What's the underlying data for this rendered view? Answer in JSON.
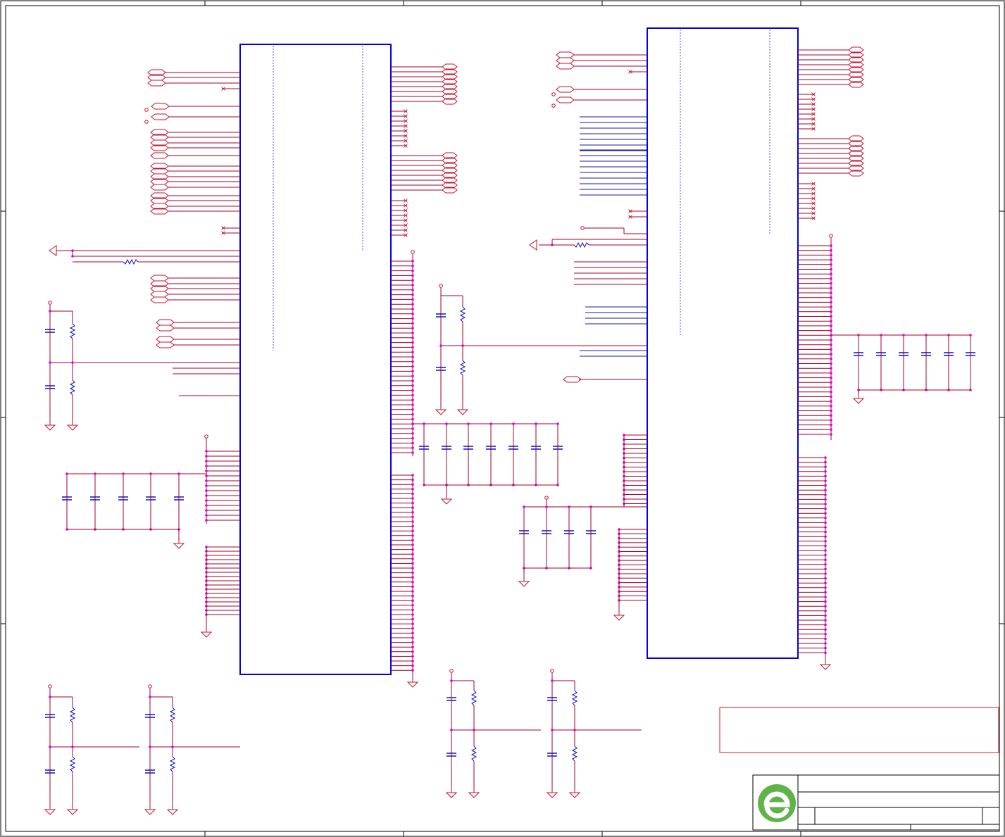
{
  "sheet": {
    "title_block": {
      "logo_icon": "green-e-logo-icon",
      "title": "",
      "document_number": "",
      "revision": "",
      "sheet_number": ""
    },
    "note_box_text": "",
    "colors": {
      "component_outline": "#0000ee",
      "net_wire": "#a4002a",
      "pin_wire": "#c8102e",
      "junction": "#e000d0",
      "logo_green": "#5fb34a"
    }
  }
}
